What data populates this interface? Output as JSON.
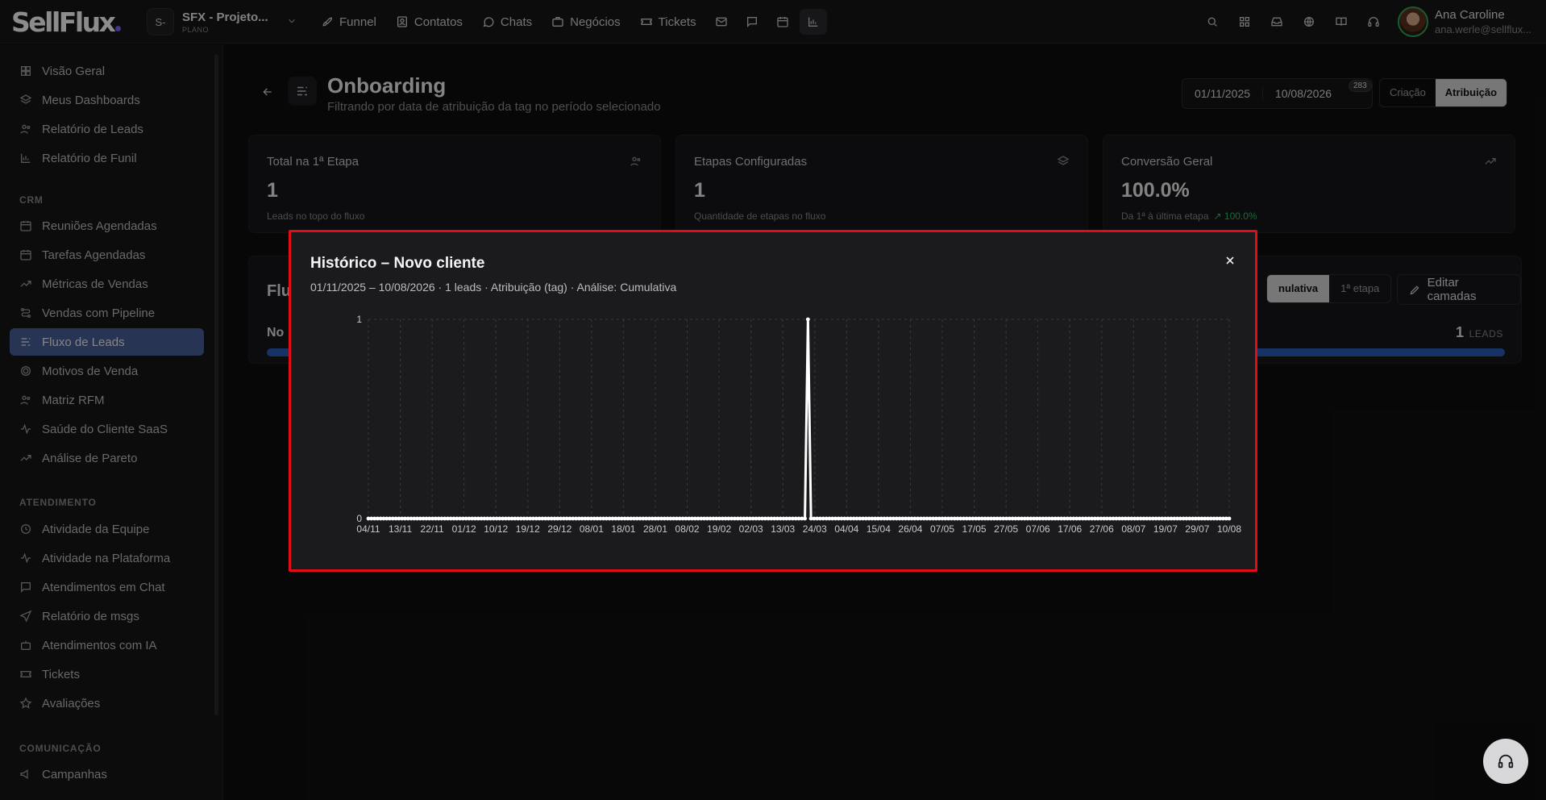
{
  "brand": {
    "logo": "SellFlux",
    "accent": "#7c5cff"
  },
  "project": {
    "badge": "S-",
    "name": "SFX - Projeto...",
    "plan": "PLANO"
  },
  "nav": [
    {
      "label": "Funnel",
      "icon": "rocket-icon"
    },
    {
      "label": "Contatos",
      "icon": "contact-icon"
    },
    {
      "label": "Chats",
      "icon": "chat-icon"
    },
    {
      "label": "Negócios",
      "icon": "briefcase-icon"
    },
    {
      "label": "Tickets",
      "icon": "ticket-icon"
    }
  ],
  "nav_icons": [
    "mail-icon",
    "message-icon",
    "calendar-icon",
    "bar-chart-icon"
  ],
  "top_right_icons": [
    "search-icon",
    "apps-grid-icon",
    "inbox-icon",
    "globe-icon",
    "book-icon",
    "headset-icon"
  ],
  "user": {
    "name": "Ana Caroline",
    "email": "ana.werle@sellflux..."
  },
  "sidebar": {
    "group1": [
      "Visão Geral",
      "Meus Dashboards",
      "Relatório de Leads",
      "Relatório de Funil"
    ],
    "crm_title": "CRM",
    "crm": [
      "Reuniões Agendadas",
      "Tarefas Agendadas",
      "Métricas de Vendas",
      "Vendas com Pipeline",
      "Fluxo de Leads",
      "Motivos de Venda",
      "Matriz RFM",
      "Saúde do Cliente SaaS",
      "Análise de Pareto"
    ],
    "atendimento_title": "ATENDIMENTO",
    "atendimento": [
      "Atividade da Equipe",
      "Atividade na Plataforma",
      "Atendimentos em Chat",
      "Relatório de msgs",
      "Atendimentos com IA",
      "Tickets",
      "Avaliações"
    ],
    "comunicacao_title": "COMUNICAÇÃO",
    "comunicacao": [
      "Campanhas"
    ],
    "active": "Fluxo de Leads"
  },
  "page": {
    "title": "Onboarding",
    "subtitle": "Filtrando por data de atribuição da tag no período selecionado",
    "date_from": "01/11/2025",
    "date_to": "10/08/2026",
    "date_badge": "283",
    "mode_options": [
      "Criação",
      "Atribuição"
    ],
    "mode_selected": "Atribuição"
  },
  "stats": [
    {
      "label": "Total na 1ª Etapa",
      "value": "1",
      "note": "Leads no topo do fluxo",
      "icon": "users-icon"
    },
    {
      "label": "Etapas Configuradas",
      "value": "1",
      "note": "Quantidade de etapas no fluxo",
      "icon": "layers-icon"
    },
    {
      "label": "Conversão Geral",
      "value": "100.0%",
      "note": "Da 1ª à última etapa",
      "trend": "100.0%",
      "icon": "trending-up-icon"
    }
  ],
  "flow": {
    "title": "Flu",
    "analysis_options": [
      "Cumulativa",
      "1ª etapa"
    ],
    "analysis_selected": "Cumulativa",
    "analysis_selected_visible": "nulativa",
    "edit_label": "Editar camadas",
    "row_label": "No",
    "count": "1",
    "count_unit": "LEADS",
    "bar_color": "#2f5bb8"
  },
  "modal": {
    "title": "Histórico – Novo cliente",
    "subtitle": "01/11/2025 – 10/08/2026 · 1 leads · Atribuição (tag) · Análise: Cumulativa",
    "border_color": "#e00d16"
  },
  "chart_data": {
    "type": "line",
    "title": "",
    "xlabel": "",
    "ylabel": "",
    "ylim": [
      0,
      1
    ],
    "yticks": [
      0,
      1
    ],
    "grid": true,
    "x_ticks": [
      "04/11",
      "13/11",
      "22/11",
      "01/12",
      "10/12",
      "19/12",
      "29/12",
      "08/01",
      "18/01",
      "28/01",
      "08/02",
      "19/02",
      "02/03",
      "13/03",
      "24/03",
      "04/04",
      "15/04",
      "26/04",
      "07/05",
      "17/05",
      "27/05",
      "07/06",
      "17/06",
      "27/06",
      "08/07",
      "19/07",
      "29/07",
      "10/08"
    ],
    "series": [
      {
        "name": "",
        "x_start": "2025-11-01",
        "x_end": "2026-08-10",
        "baseline": 0,
        "points": [
          {
            "x": "2026-03-25",
            "y": 1
          }
        ],
        "color": "#ffffff"
      }
    ]
  }
}
